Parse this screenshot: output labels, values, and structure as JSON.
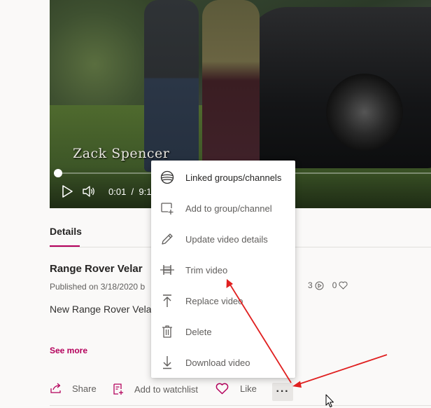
{
  "video": {
    "caption": "Zack Spencer",
    "current_time": "0:01",
    "time_separator": "/",
    "duration_partial": "9:1",
    "progress_fraction": 0.012
  },
  "details": {
    "tab_label": "Details",
    "title": "Range Rover Velar",
    "published": "Published on 3/18/2020 b",
    "views": "3",
    "likes": "0",
    "description": "New Range Rover Velar",
    "see_more": "See more"
  },
  "actions": {
    "share": "Share",
    "watchlist": "Add to watchlist",
    "like": "Like",
    "more": "···"
  },
  "menu": {
    "items": [
      {
        "label": "Linked groups/channels",
        "icon": "globe-icon"
      },
      {
        "label": "Add to group/channel",
        "icon": "add-group-icon"
      },
      {
        "label": "Update video details",
        "icon": "pencil-icon"
      },
      {
        "label": "Trim video",
        "icon": "trim-icon"
      },
      {
        "label": "Replace video",
        "icon": "upload-icon"
      },
      {
        "label": "Delete",
        "icon": "trash-icon"
      },
      {
        "label": "Download video",
        "icon": "download-icon"
      }
    ]
  },
  "colors": {
    "accent": "#b4005c",
    "annotation_arrow": "#e02020"
  }
}
